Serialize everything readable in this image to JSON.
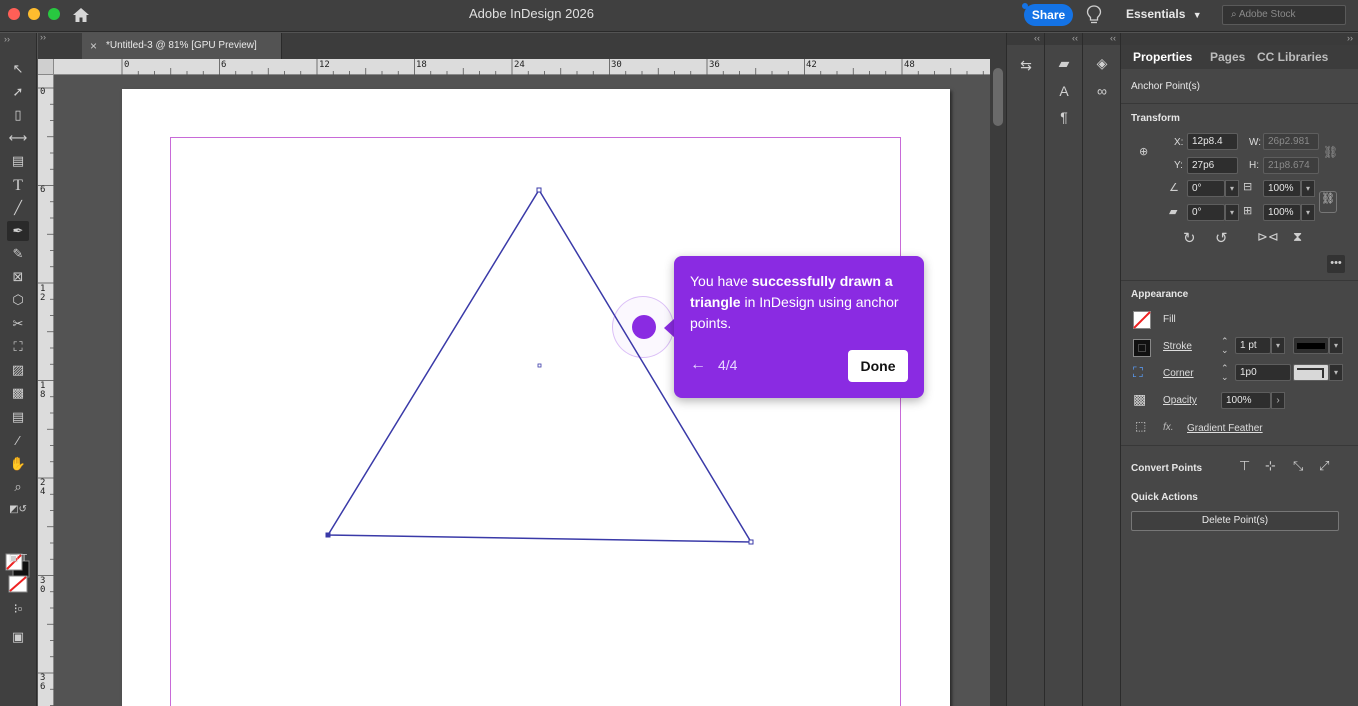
{
  "app": {
    "title": "Adobe InDesign 2026",
    "share_label": "Share",
    "workspace": "Essentials",
    "stock_placeholder": "Adobe Stock"
  },
  "document": {
    "tab_title": "*Untitled-3 @ 81% [GPU Preview]",
    "close_glyph": "×"
  },
  "rulers": {
    "horizontal": [
      "0",
      "6",
      "12",
      "18",
      "24",
      "30",
      "36",
      "42",
      "48"
    ],
    "vertical": [
      "0",
      "6",
      "1\n2",
      "1\n8",
      "2\n4",
      "3\n0",
      "3\n6"
    ]
  },
  "panel": {
    "tabs": [
      "Properties",
      "Pages",
      "CC Libraries"
    ],
    "selection_label": "Anchor Point(s)",
    "transform": {
      "title": "Transform",
      "x_label": "X:",
      "x_value": "12p8.4",
      "y_label": "Y:",
      "y_value": "27p6",
      "w_label": "W:",
      "w_value": "26p2.981",
      "h_label": "H:",
      "h_value": "21p8.674",
      "rotate_value": "0°",
      "shear_value": "0°",
      "scale_x": "100%",
      "scale_y": "100%"
    },
    "appearance": {
      "title": "Appearance",
      "fill_label": "Fill",
      "stroke_label": "Stroke",
      "stroke_weight": "1 pt",
      "corner_label": "Corner",
      "corner_value": "1p0",
      "opacity_label": "Opacity",
      "opacity_value": "100%",
      "fx_label": "fx.",
      "gradient_feather_label": "Gradient Feather"
    },
    "convert_points": {
      "title": "Convert Points"
    },
    "quick_actions": {
      "title": "Quick Actions",
      "delete_label": "Delete Point(s)"
    }
  },
  "tooltip": {
    "text_1": "You have ",
    "text_bold_1": "successfully drawn a triangle",
    "text_2": " in InDesign using anchor points.",
    "step": "4/4",
    "back_glyph": "←",
    "done_label": "Done"
  },
  "colors": {
    "accent_purple": "#8a2be2",
    "share_blue": "#1473e6",
    "triangle_stroke": "#3a3aa8",
    "margin_guide": "#c86ad8"
  }
}
